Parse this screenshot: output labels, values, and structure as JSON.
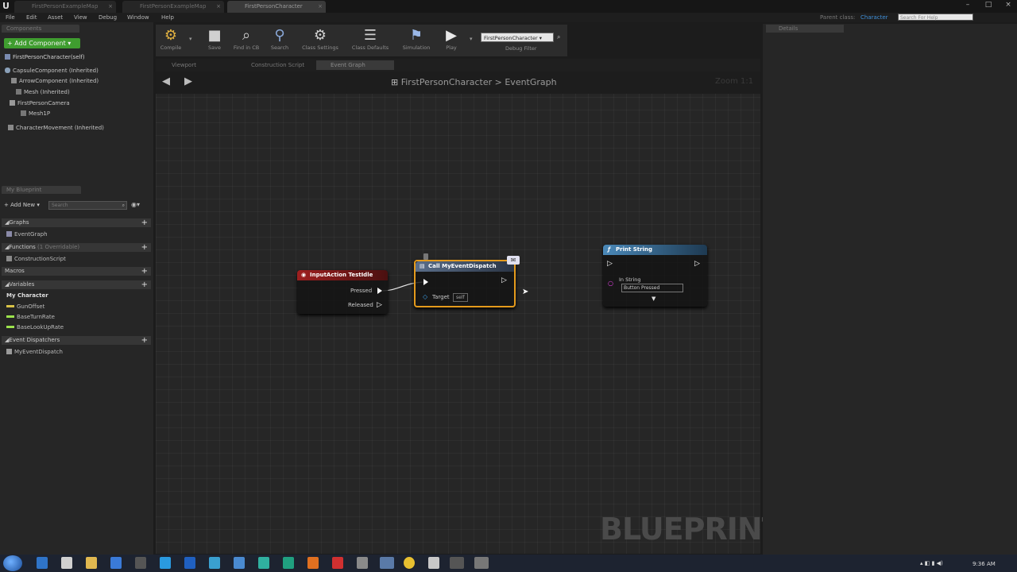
{
  "doc_tabs": [
    {
      "label": "FirstPersonExampleMap"
    },
    {
      "label": "FirstPersonExampleMap"
    },
    {
      "label": "FirstPersonCharacter"
    }
  ],
  "menu": [
    "File",
    "Edit",
    "Asset",
    "View",
    "Debug",
    "Window",
    "Help"
  ],
  "parent_class": {
    "label": "Parent class:",
    "value": "Character"
  },
  "help_search": {
    "placeholder": "Search For Help"
  },
  "components": {
    "tab": "Components",
    "add_button": "Add Component",
    "items": [
      "FirstPersonCharacter(self)",
      "CapsuleComponent (Inherited)",
      "ArrowComponent (Inherited)",
      "Mesh (Inherited)",
      "FirstPersonCamera",
      "Mesh1P",
      "CharacterMovement (Inherited)"
    ]
  },
  "my_blueprint": {
    "tab": "My Blueprint",
    "add_new": "Add New",
    "search_placeholder": "Search",
    "graphs_label": "Graphs",
    "event_graph": "EventGraph",
    "functions_label": "Functions",
    "functions_count": "(1 Overridable)",
    "construction_script": "ConstructionScript",
    "macros_label": "Macros",
    "variables_label": "Variables",
    "my_character": "My Character",
    "variables": [
      {
        "name": "GunOffset",
        "color": "#d8c247"
      },
      {
        "name": "BaseTurnRate",
        "color": "#9be24c"
      },
      {
        "name": "BaseLookUpRate",
        "color": "#9be24c"
      }
    ],
    "dispatchers_label": "Event Dispatchers",
    "dispatcher": "MyEventDispatch"
  },
  "toolbar": [
    {
      "label": "Compile",
      "icon": "compile-icon"
    },
    {
      "label": "Save",
      "icon": "save-icon"
    },
    {
      "label": "Find in CB",
      "icon": "find-icon"
    },
    {
      "label": "Search",
      "icon": "search-icon"
    },
    {
      "label": "Class Settings",
      "icon": "gear-icon"
    },
    {
      "label": "Class Defaults",
      "icon": "defaults-icon"
    },
    {
      "label": "Simulation",
      "icon": "simulation-icon"
    },
    {
      "label": "Play",
      "icon": "play-icon"
    }
  ],
  "debug": {
    "selected": "FirstPersonCharacter",
    "label": "Debug Filter"
  },
  "editor_tabs": [
    "Viewport",
    "Construction Script",
    "Event Graph"
  ],
  "graph": {
    "crumb_root": "FirstPersonCharacter",
    "crumb_leaf": "EventGraph",
    "zoom": "Zoom 1:1",
    "watermark": "BLUEPRINT"
  },
  "nodes": {
    "input_action": {
      "title": "InputAction TestIdle",
      "pin_pressed": "Pressed",
      "pin_released": "Released"
    },
    "call_dispatch": {
      "title": "Call MyEventDispatch",
      "pin_target": "Target",
      "target_value": "self"
    },
    "print_string": {
      "title": "Print String",
      "pin_in_string": "In String",
      "in_string_value": "Button Pressed"
    }
  },
  "details": {
    "tab": "Details"
  },
  "taskbar": {
    "time": "9:36 AM"
  }
}
